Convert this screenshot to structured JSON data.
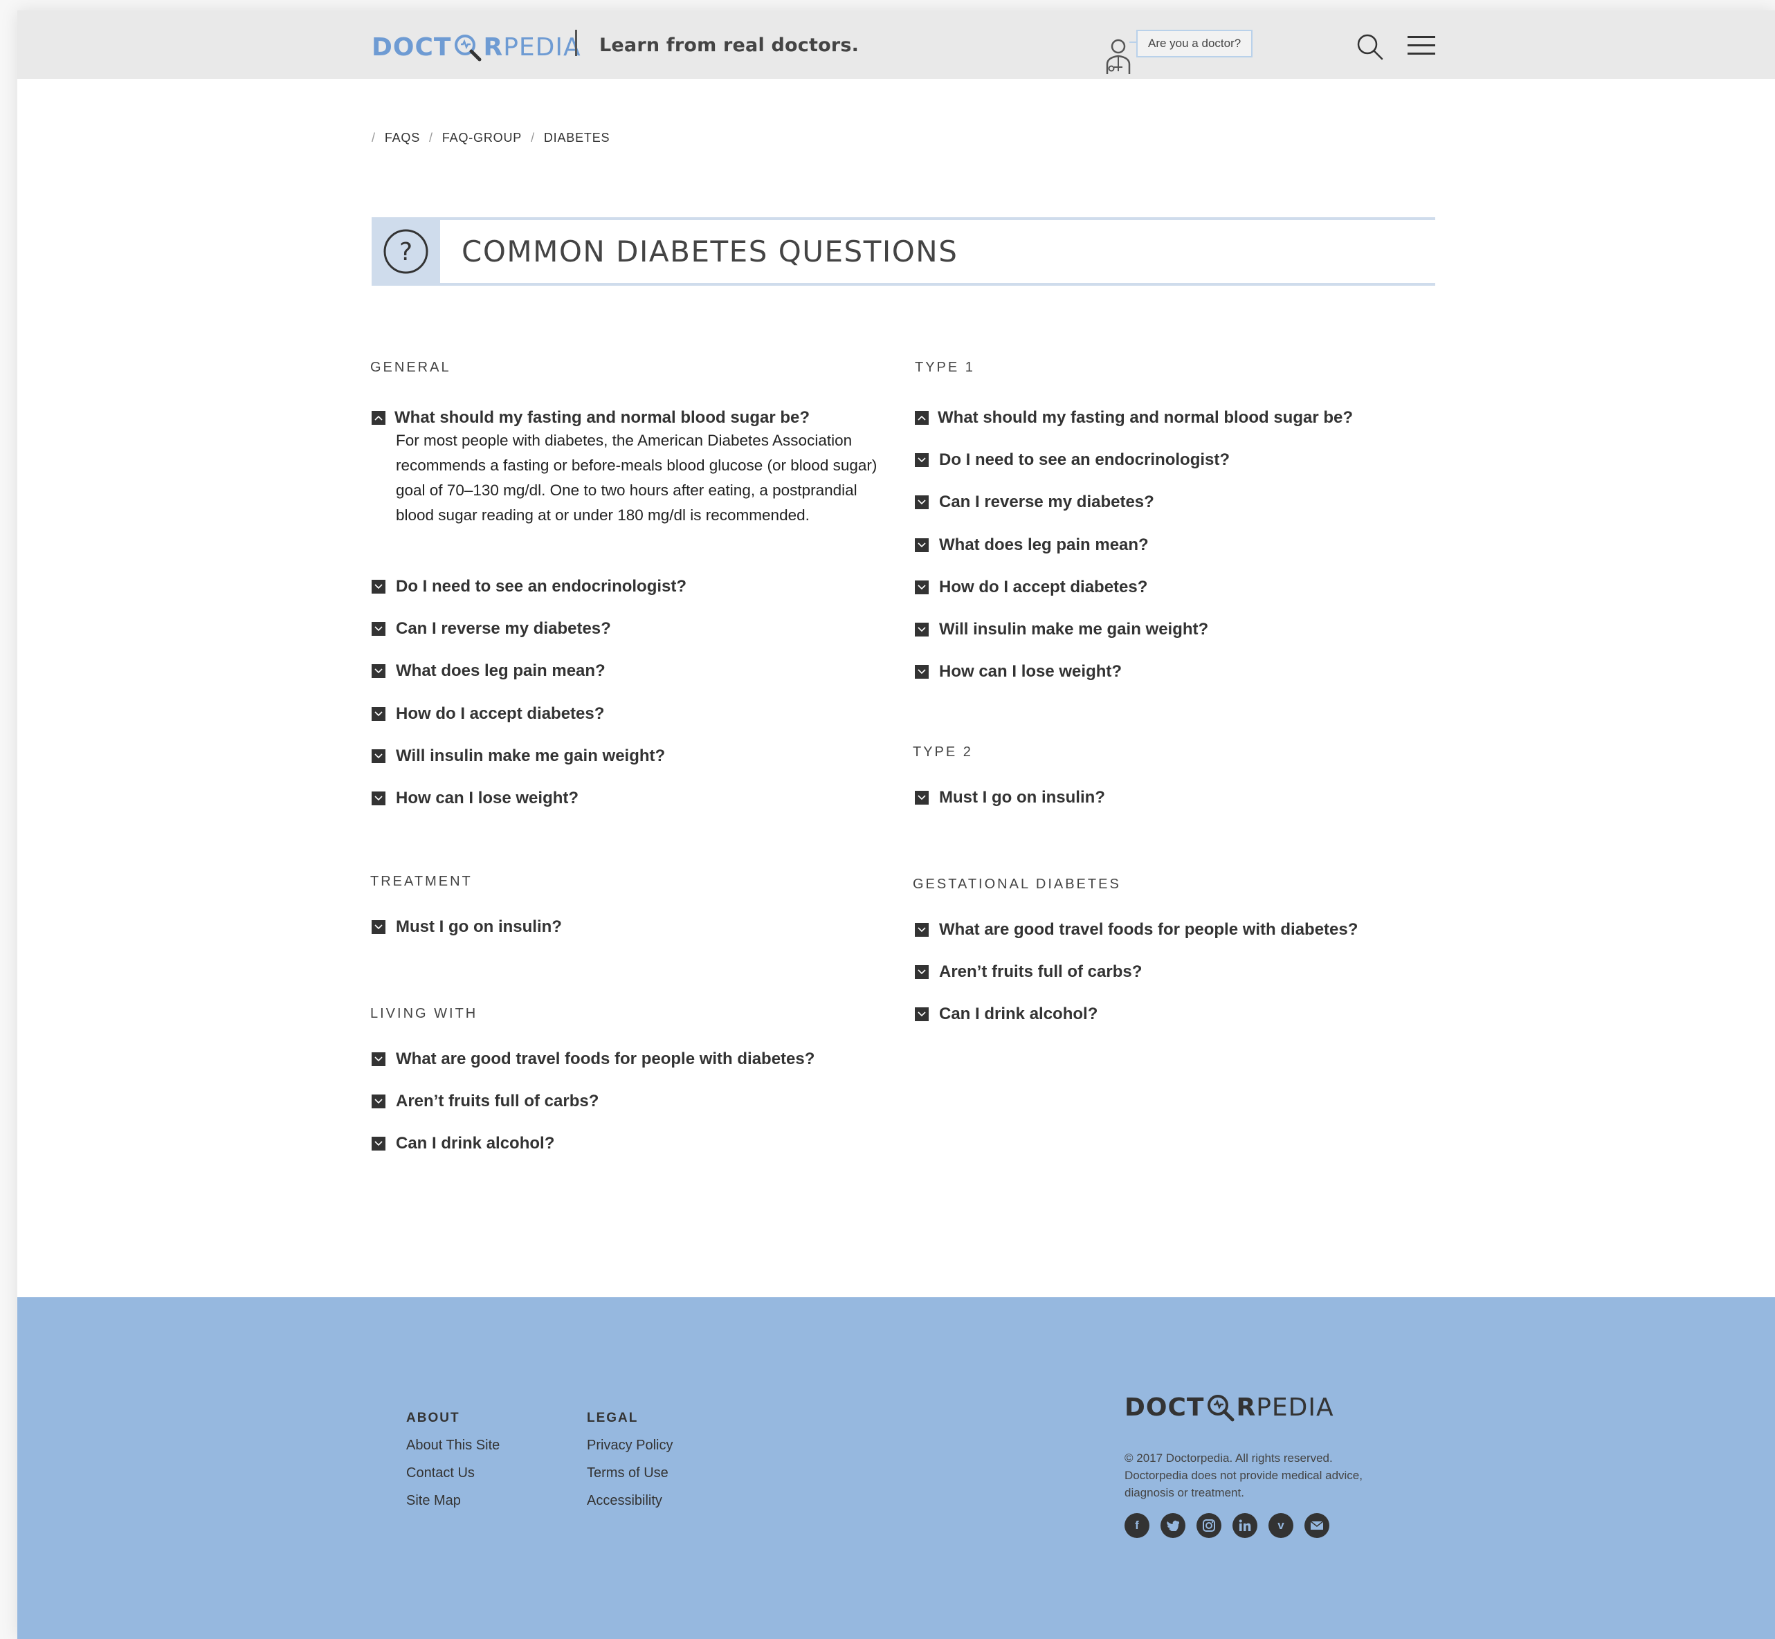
{
  "header": {
    "logo_left": "DOCT",
    "logo_right": "R",
    "logo_pedia": "PEDIA",
    "tagline": "Learn from real doctors.",
    "doctor_prompt": "Are you a doctor?",
    "brand_color": "#6e9bd3"
  },
  "breadcrumb": {
    "items": [
      "FAQS",
      "FAQ-GROUP",
      "DIABETES"
    ],
    "separator": "/"
  },
  "title": {
    "text": "COMMON DIABETES QUESTIONS",
    "icon": "question-mark-icon",
    "accent": "#cfdcec"
  },
  "sections": {
    "general": {
      "title": "GENERAL",
      "open_question": "What should my fasting and normal blood sugar be?",
      "answer": "For most people with diabetes, the American Diabetes Association recommends a fasting or before-meals blood glucose (or blood sugar) goal of 70–130 mg/dl. One to two hours after eating, a postprandial blood sugar reading at or under 180 mg/dl is recommended.",
      "questions": [
        "Do I need to see an endocrinologist?",
        "Can I reverse my diabetes?",
        "What does leg pain mean?",
        "How do I accept diabetes?",
        "Will insulin make me gain weight?",
        "How can I lose weight?"
      ]
    },
    "treatment": {
      "title": "TREATMENT",
      "questions": [
        "Must I go on insulin?"
      ]
    },
    "living_with": {
      "title": "LIVING WITH",
      "questions": [
        "What are good travel foods for people with diabetes?",
        "Aren’t fruits full of carbs?",
        "Can I drink alcohol?"
      ]
    },
    "type1": {
      "title": "TYPE 1",
      "questions": [
        "What should my fasting and normal blood sugar be?",
        "Do I need to see an endocrinologist?",
        "Can I reverse my diabetes?",
        "What does leg pain mean?",
        "How do I accept diabetes?",
        "Will insulin make me gain weight?",
        "How can I lose weight?"
      ]
    },
    "type2": {
      "title": "TYPE 2",
      "questions": [
        "Must I go on insulin?"
      ]
    },
    "gestational": {
      "title": "GESTATIONAL DIABETES",
      "questions": [
        "What are good travel foods for people with diabetes?",
        "Aren’t fruits full of carbs?",
        "Can I drink alcohol?"
      ]
    }
  },
  "footer": {
    "background": "#96b8df",
    "about": {
      "heading": "ABOUT",
      "links": [
        "About This Site",
        "Contact Us",
        "Site Map"
      ]
    },
    "legal": {
      "heading": "LEGAL",
      "links": [
        "Privacy Policy",
        "Terms of Use",
        "Accessibility"
      ]
    },
    "copyright": "© 2017 Doctorpedia. All rights reserved.",
    "disclaimer": "Doctorpedia does not provide medical advice, diagnosis or treatment.",
    "social": {
      "facebook": "f",
      "vimeo": "v",
      "icons": [
        "facebook-icon",
        "twitter-icon",
        "instagram-icon",
        "linkedin-icon",
        "vimeo-icon",
        "email-icon"
      ]
    }
  }
}
